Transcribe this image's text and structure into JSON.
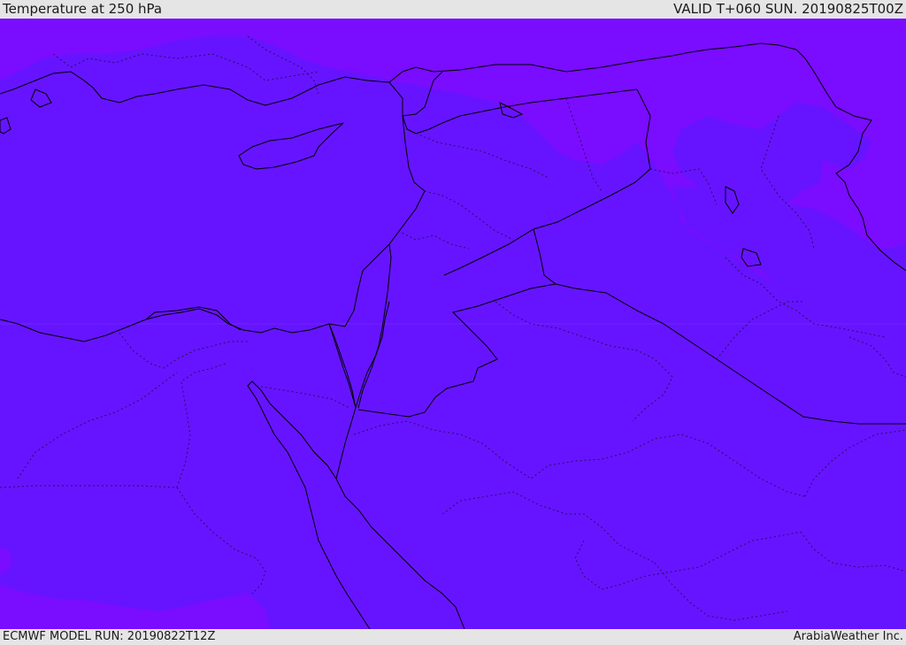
{
  "header": {
    "title": "Temperature at 250 hPa",
    "valid_time": "VALID T+060 SUN. 20190825T00Z"
  },
  "footer": {
    "model_run": "ECMWF MODEL RUN: 20190822T12Z",
    "credit": "ArabiaWeather Inc."
  },
  "map": {
    "colors": {
      "field_main": "#6614ff",
      "field_warm": "#7a0cff",
      "coastline": "#000000",
      "border": "#000000"
    }
  }
}
